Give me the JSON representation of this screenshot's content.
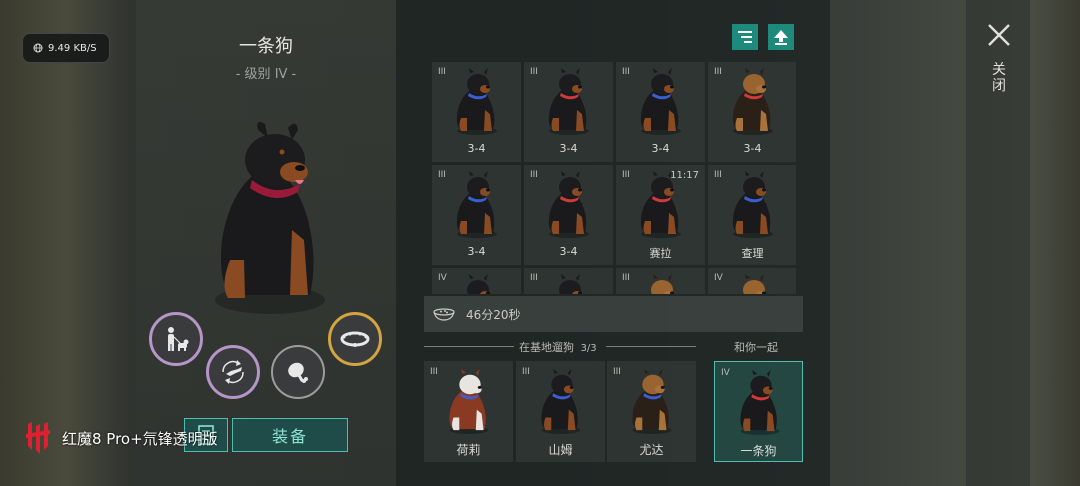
{
  "status": {
    "net_speed": "9.49 KB/S"
  },
  "dog_detail": {
    "name": "一条狗",
    "level": "- 级别 IV -"
  },
  "actions": {
    "equip_label": "装备"
  },
  "watermark": {
    "text": "红魔8 Pro+氘锋透明版"
  },
  "timer": {
    "text": "46分20秒"
  },
  "sections": {
    "at_base": "在基地遛狗",
    "at_base_count": "3/3",
    "with_you": "和你一起"
  },
  "close": {
    "label": "关闭"
  },
  "grid": [
    {
      "level": "III",
      "label": "3-4",
      "time": "",
      "breed": "rottweiler",
      "collar": "#3a5fd0"
    },
    {
      "level": "III",
      "label": "3-4",
      "time": "",
      "breed": "rottweiler",
      "collar": "#d03a3a"
    },
    {
      "level": "III",
      "label": "3-4",
      "time": "",
      "breed": "rottweiler",
      "collar": "#3a5fd0"
    },
    {
      "level": "III",
      "label": "3-4",
      "time": "",
      "breed": "shepherd",
      "collar": "#d03a3a"
    },
    {
      "level": "III",
      "label": "3-4",
      "time": "",
      "breed": "rottweiler",
      "collar": "#3a5fd0"
    },
    {
      "level": "III",
      "label": "3-4",
      "time": "",
      "breed": "rottweiler",
      "collar": "#d03a3a"
    },
    {
      "level": "III",
      "label": "赛拉",
      "time": "11:17",
      "breed": "rottweiler",
      "collar": "#d03a3a"
    },
    {
      "level": "III",
      "label": "查理",
      "time": "",
      "breed": "rottweiler",
      "collar": "#3a5fd0"
    },
    {
      "level": "IV",
      "label": "",
      "time": "",
      "breed": "rottweiler",
      "collar": "#3a5fd0"
    },
    {
      "level": "III",
      "label": "",
      "time": "",
      "breed": "rottweiler",
      "collar": "#d03a3a"
    },
    {
      "level": "III",
      "label": "",
      "time": "",
      "breed": "shepherd",
      "collar": "#d03a3a"
    },
    {
      "level": "IV",
      "label": "",
      "time": "",
      "breed": "shepherd",
      "collar": "#3a5fd0"
    }
  ],
  "base_dogs": [
    {
      "level": "III",
      "name": "荷莉",
      "breed": "husky",
      "collar": "#3a5fd0"
    },
    {
      "level": "III",
      "name": "山姆",
      "breed": "rottweiler",
      "collar": "#3a5fd0"
    },
    {
      "level": "III",
      "name": "尤达",
      "breed": "shepherd",
      "collar": "#3a5fd0"
    }
  ],
  "with_you_dog": {
    "level": "IV",
    "name": "一条狗",
    "breed": "rottweiler",
    "collar": "#d03a3a"
  }
}
